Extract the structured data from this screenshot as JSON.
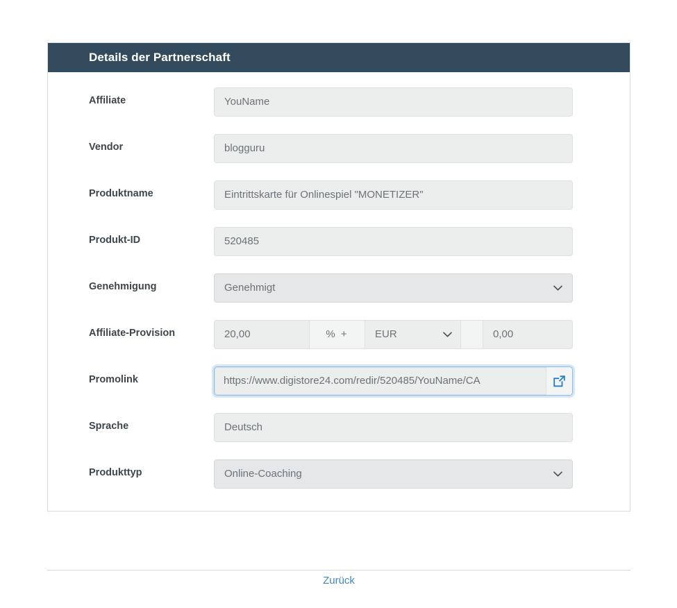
{
  "card": {
    "header_title": "Details der Partnerschaft"
  },
  "form": {
    "affiliate": {
      "label": "Affiliate",
      "value": "YouName"
    },
    "vendor": {
      "label": "Vendor",
      "value": "blogguru"
    },
    "product_name": {
      "label": "Produktname",
      "value": "Eintrittskarte für Onlinespiel \"MONETIZER\""
    },
    "product_id": {
      "label": "Produkt-ID",
      "value": "520485"
    },
    "approval": {
      "label": "Genehmigung",
      "value": "Genehmigt"
    },
    "commission": {
      "label": "Affiliate-Provision",
      "rate": "20,00",
      "addon": "%  +",
      "currency": "EUR",
      "fixed": "0,00"
    },
    "promolink": {
      "label": "Promolink",
      "value": "https://www.digistore24.com/redir/520485/YouName/CA",
      "open_icon": "external-link-icon"
    },
    "language": {
      "label": "Sprache",
      "value": "Deutsch"
    },
    "product_type": {
      "label": "Produkttyp",
      "value": "Online-Coaching"
    }
  },
  "footer": {
    "back_label": "Zurück"
  },
  "colors": {
    "header_bg": "#334a5c",
    "field_bg": "#eceded",
    "link_blue": "#3f87c8",
    "focus_blue": "#89bde8",
    "label_text": "#3d464d",
    "value_text": "#6b7278"
  }
}
